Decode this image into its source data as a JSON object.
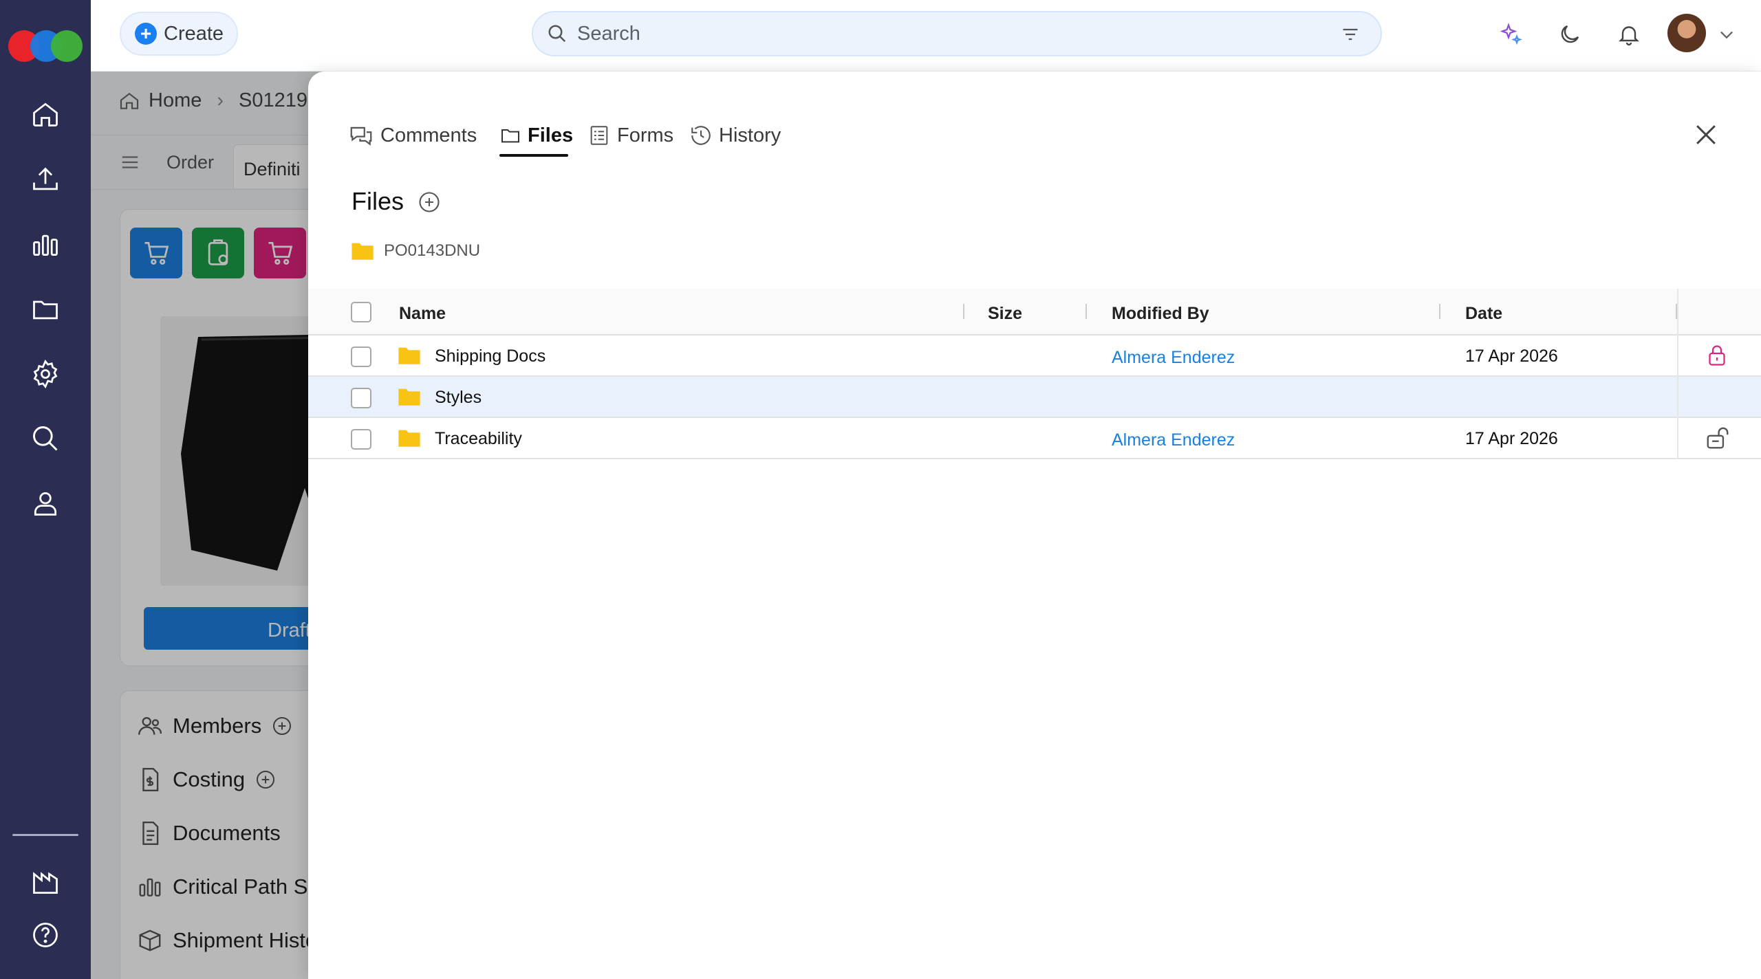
{
  "brand": {
    "logo_colors": [
      "#e8242a",
      "#1f7ae0",
      "#3fb23a"
    ]
  },
  "nav": {
    "items": [
      {
        "icon": "home-icon"
      },
      {
        "icon": "upload-icon"
      },
      {
        "icon": "bar-chart-icon"
      },
      {
        "icon": "folder-icon"
      },
      {
        "icon": "gear-icon"
      },
      {
        "icon": "search-icon"
      },
      {
        "icon": "user-icon"
      }
    ],
    "bottom": [
      {
        "icon": "factory-icon"
      },
      {
        "icon": "help-icon"
      }
    ]
  },
  "topbar": {
    "create_label": "Create",
    "search_placeholder": "Search"
  },
  "page": {
    "breadcrumb": {
      "home": "Home",
      "current": "S01219"
    },
    "subnav": {
      "tab1": "Order",
      "tab2": "Definiti"
    },
    "draft_label": "Draft",
    "menu": {
      "members": "Members",
      "costing": "Costing",
      "documents": "Documents",
      "critical_path": "Critical Path Su",
      "shipment_history": "Shipment Histo"
    }
  },
  "panel": {
    "tabs": {
      "comments": "Comments",
      "files": "Files",
      "forms": "Forms",
      "history": "History"
    },
    "files_title": "Files",
    "folder_path": "PO0143DNU",
    "columns": {
      "name": "Name",
      "size": "Size",
      "modified_by": "Modified By",
      "date": "Date"
    },
    "rows": [
      {
        "name": "Shipping Docs",
        "modified_by": "Almera Enderez",
        "date": "17 Apr 2026",
        "lock": "locked"
      },
      {
        "name": "Styles",
        "modified_by": "",
        "date": "",
        "lock": "none"
      },
      {
        "name": "Traceability",
        "modified_by": "Almera Enderez",
        "date": "17 Apr 2026",
        "lock": "unlocked"
      }
    ]
  }
}
